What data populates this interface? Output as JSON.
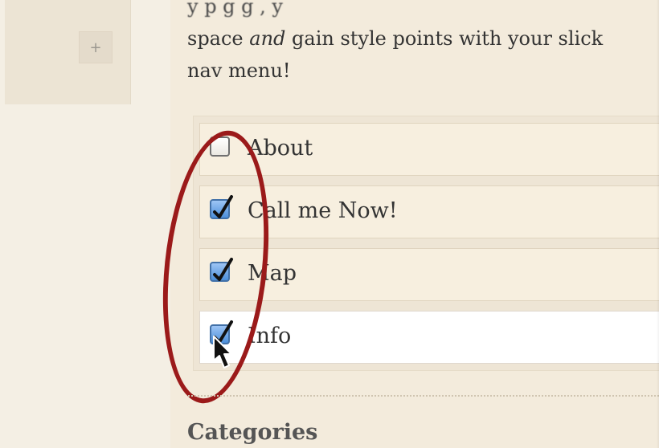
{
  "sidebar": {
    "add_button_label": "+"
  },
  "intro": {
    "line1": "y                     p g          g    ,  y",
    "line2_before": "space ",
    "line2_emphasis": "and",
    "line2_after": " gain style points with your slick",
    "line3": "nav menu!"
  },
  "menu": {
    "items": [
      {
        "label": "About",
        "checked": false
      },
      {
        "label": "Call me Now!",
        "checked": true
      },
      {
        "label": "Map",
        "checked": true
      },
      {
        "label": "Info",
        "checked": true
      }
    ]
  },
  "section": {
    "title": "Categories"
  },
  "colors": {
    "annotation": "#9b1a1a",
    "checkbox_checked": "#4c8fda",
    "background": "#f3ecdf"
  },
  "icons": {
    "add": "plus-icon",
    "check": "checkmark-icon",
    "cursor": "mouse-pointer-icon"
  }
}
